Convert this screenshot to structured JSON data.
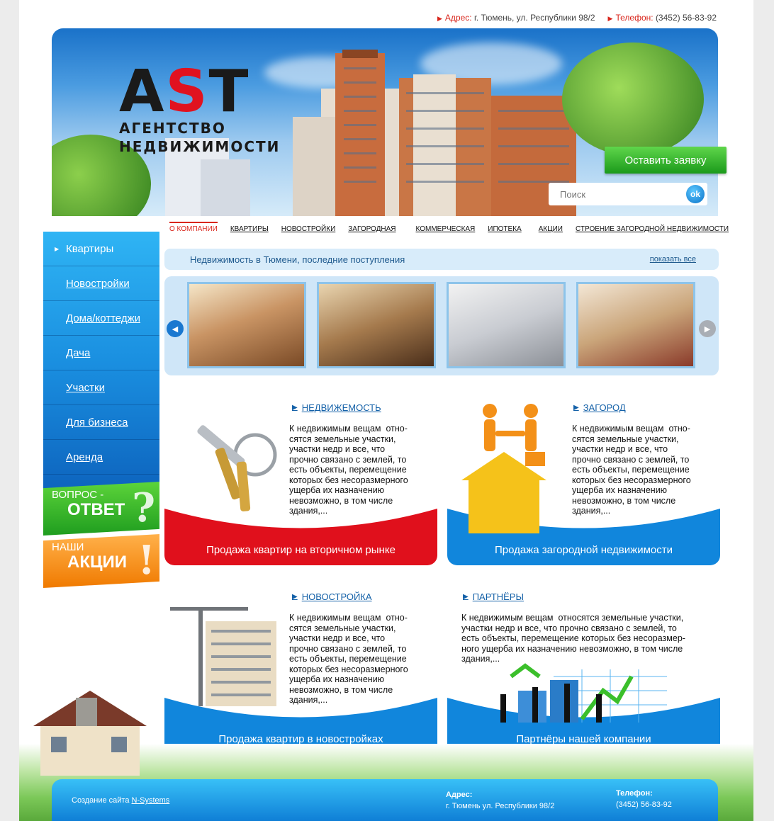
{
  "contacts": {
    "address_label": "Адрес:",
    "address_value": "г. Тюмень, ул. Республики 98/2",
    "phone_label": "Телефон:",
    "phone_value": "(3452) 56-83-92"
  },
  "logo": {
    "mark_a": "A",
    "mark_s": "S",
    "mark_t": "T",
    "line1": "АГЕНТСТВО",
    "line2": "НЕДВИЖИМОСТИ"
  },
  "header": {
    "request_button": "Оставить заявку",
    "search_placeholder": "Поиск",
    "search_button": "ok"
  },
  "nav": [
    "О компании",
    "Квартиры",
    "Новостройки",
    "Загородная",
    "Коммерческая",
    "Ипотека",
    "Акции",
    "Строение загородной недвижимости"
  ],
  "sidebar": {
    "items": [
      "Квартиры",
      "Новостройки",
      "Дома/коттеджи",
      "Дача",
      "Участки",
      "Для бизнеса",
      "Аренда"
    ],
    "promo_qa": {
      "line1": "ВОПРОС -",
      "line2": "ОТВЕТ",
      "mark": "?"
    },
    "promo_actions": {
      "line1": "НАШИ",
      "line2": "АКЦИИ",
      "mark": "!"
    }
  },
  "latest": {
    "title": "Недвижимость в Тюмени, последние поступления",
    "show_all": "показать все"
  },
  "blocks": [
    {
      "title": "Недвижемость",
      "text": "К недвижимым вещам  отно-\nсятся земельные участки,\nучастки недр и все, что\nпрочно связано с землей, то\nесть объекты, перемещение\nкоторых без несоразмерного\nущерба их назначению\nневозможно, в том числе\nздания,...",
      "bar_label": "Продажа квартир на вторичном рынке"
    },
    {
      "title": "Загород",
      "text": "К недвижимым вещам  отно-\nсятся земельные участки,\nучастки недр и все, что\nпрочно связано с землей, то\nесть объекты, перемещение\nкоторых без несоразмерного\nущерба их назначению\nневозможно, в том числе\nздания,...",
      "bar_label": "Продажа загородной недвижимости"
    },
    {
      "title": "Новостройка",
      "text": "К недвижимым вещам  отно-\nсятся земельные участки,\nучастки недр и все, что\nпрочно связано с землей, то\nесть объекты, перемещение\nкоторых без несоразмерного\nущерба их назначению\nневозможно, в том числе\nздания,...",
      "bar_label": "Продажа квартир в новостройках"
    },
    {
      "title": "Партнёры",
      "text": "К недвижимым вещам  относятся земельные участки,\nучастки недр и все, что прочно связано с землей, то\nесть объекты, перемещение которых без несоразмер-\nного ущерба их назначению невозможно, в том числе\nздания,...",
      "bar_label": "Партнёры нашей компании"
    }
  ],
  "footer": {
    "credit_prefix": "Создание сайта ",
    "credit_link": "N-Systems",
    "address_label": "Адрес:",
    "address_value": "г. Тюмень  ул. Республики 98/2",
    "phone_label": "Телефон:",
    "phone_value": "(3452) 56-83-92"
  },
  "colors": {
    "brand_red": "#d9261c",
    "brand_blue": "#1a8fe0",
    "accent_green": "#1b9a1b",
    "accent_orange": "#f07a00"
  },
  "icons": [
    "triangle-right-icon",
    "arrow-left-icon",
    "arrow-right-icon",
    "question-mark-icon",
    "exclamation-mark-icon"
  ]
}
